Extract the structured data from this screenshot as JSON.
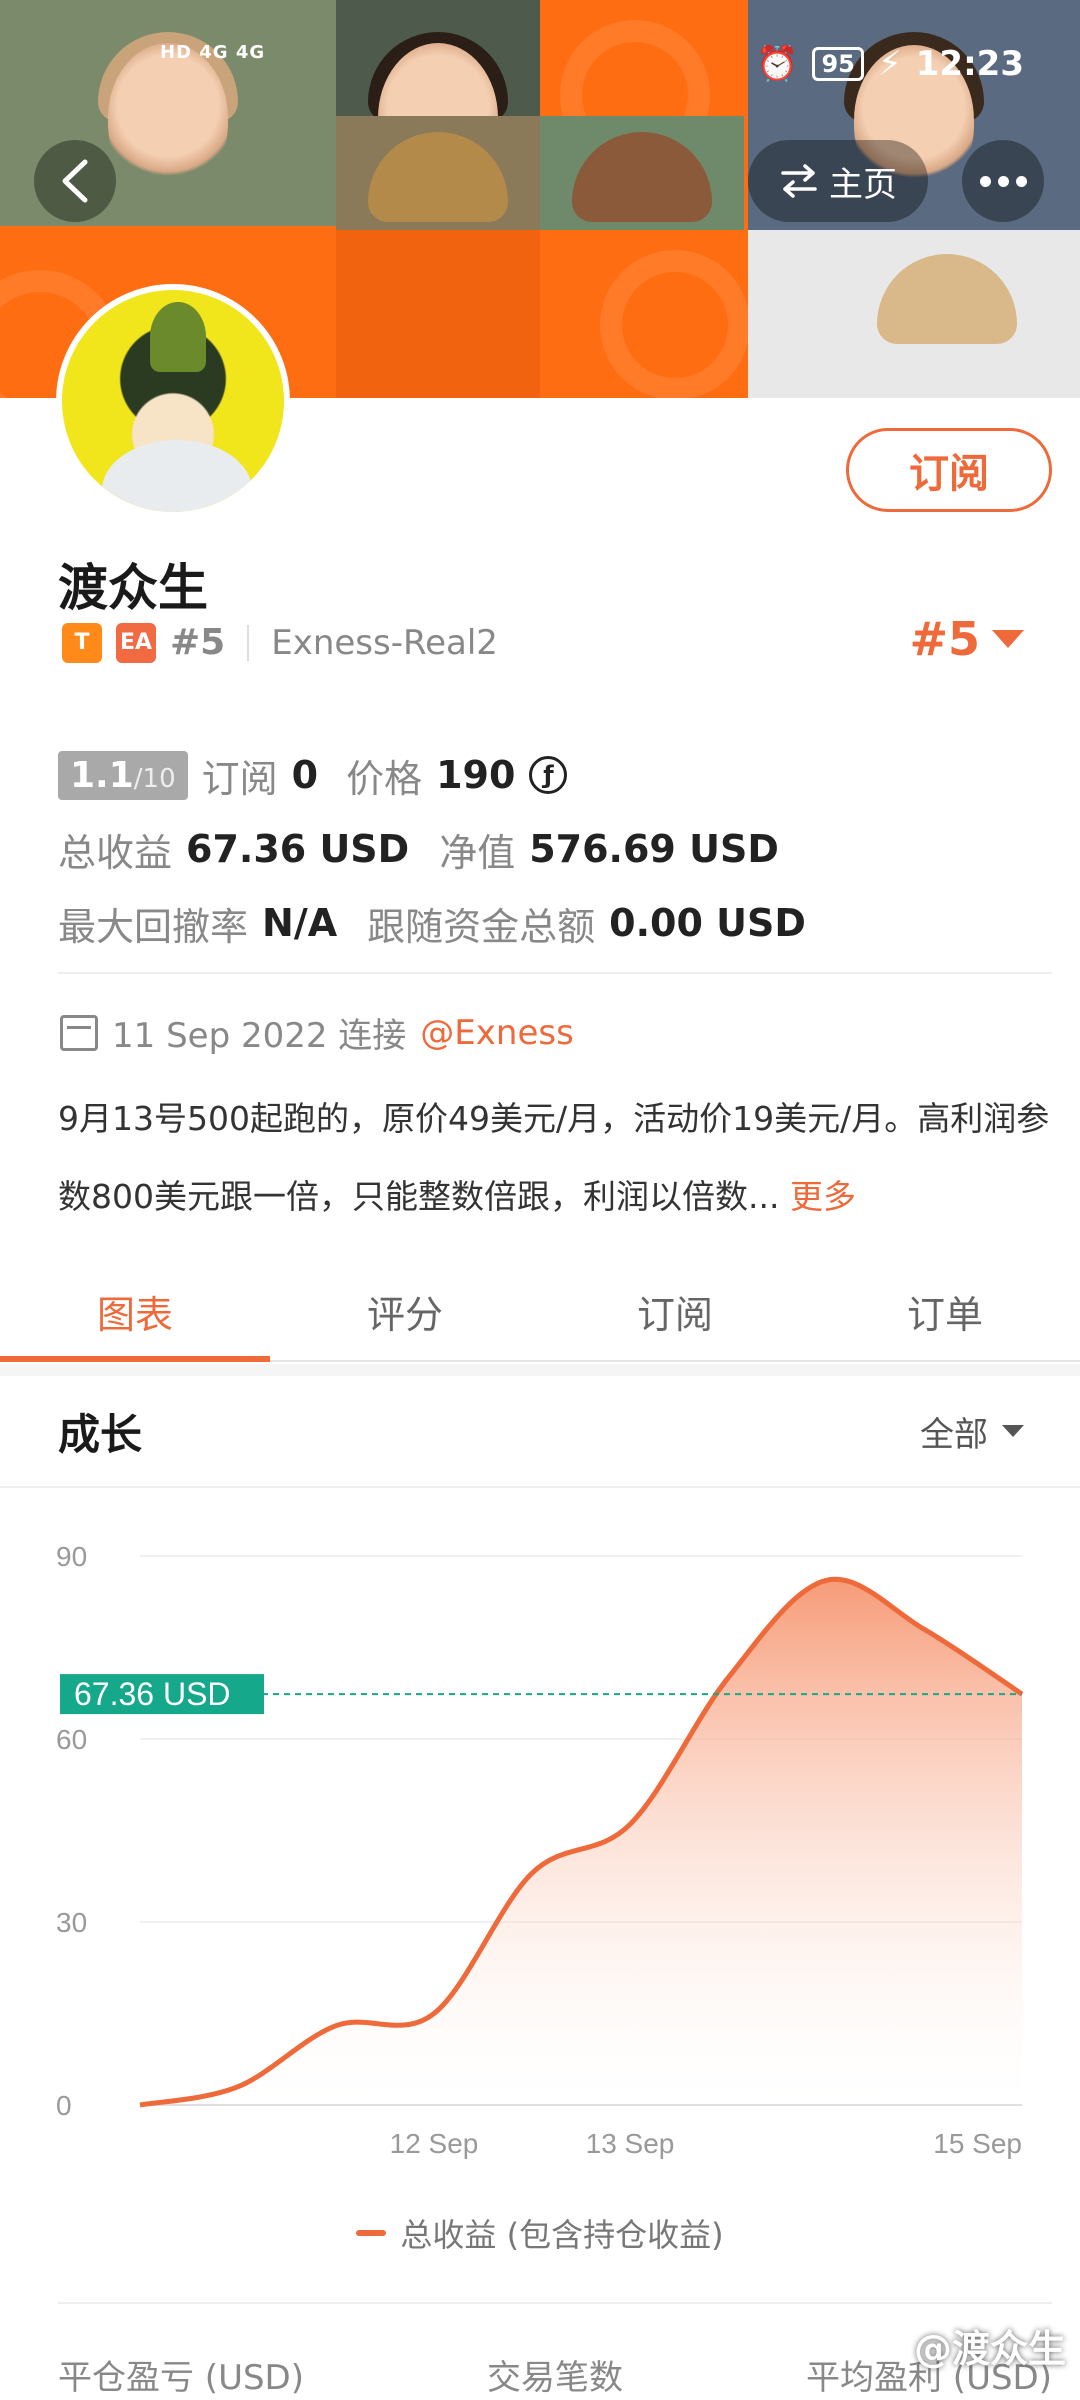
{
  "status_bar": {
    "signal": "HD 4G 4G",
    "battery": "95",
    "time": "12:23"
  },
  "nav": {
    "home_label": "主页"
  },
  "profile": {
    "subscribe_label": "订阅",
    "name": "渡众生",
    "tag_t": "T",
    "tag_ea": "EA",
    "rank_small": "#5",
    "server": "Exness-Real2",
    "rank_big": "#5"
  },
  "stats": {
    "score": "1.1",
    "score_max": "/10",
    "subs_label": "订阅",
    "subs_value": "0",
    "price_label": "价格",
    "price_value": "190",
    "coin_symbol": "ƒ",
    "total_label": "总收益",
    "total_value": "67.36 USD",
    "equity_label": "净值",
    "equity_value": "576.69 USD",
    "drawdown_label": "最大回撤率",
    "drawdown_value": "N/A",
    "follow_label": "跟随资金总额",
    "follow_value": "0.00 USD"
  },
  "info": {
    "date": "11 Sep 2022 连接",
    "broker": "@Exness",
    "desc": "9月13号500起跑的，原价49美元/月，活动价19美元/月。高利润参数800美元跟一倍，只能整数倍跟，利润以倍数...",
    "more": "更多"
  },
  "tabs": [
    "图表",
    "评分",
    "订阅",
    "订单"
  ],
  "section": {
    "title": "成长",
    "filter": "全部"
  },
  "chart_data": {
    "type": "area",
    "ylim": [
      0,
      90
    ],
    "y_ticks": [
      "90",
      "60",
      "30",
      "0"
    ],
    "x_ticks": [
      "12 Sep",
      "13 Sep",
      "15 Sep"
    ],
    "x": [
      "11 Sep",
      "11 Sep",
      "12 Sep",
      "12 Sep",
      "13 Sep",
      "13 Sep",
      "14 Sep",
      "14 Sep",
      "15 Sep",
      "15 Sep"
    ],
    "series": [
      {
        "name": "总收益 (包含持仓收益)",
        "values": [
          0,
          3,
          13,
          15,
          38,
          46,
          70,
          86,
          78,
          67.36
        ]
      }
    ],
    "current_label": "67.36 USD",
    "current_value": 67.36,
    "line_color": "#ee6a3a",
    "label_color": "#16a88a"
  },
  "legend_label": "总收益 (包含持仓收益)",
  "footer": {
    "col1": "平仓盈亏 (USD)",
    "col2": "交易笔数",
    "col3": "平均盈利 (USD)"
  },
  "watermark": "@渡众生"
}
